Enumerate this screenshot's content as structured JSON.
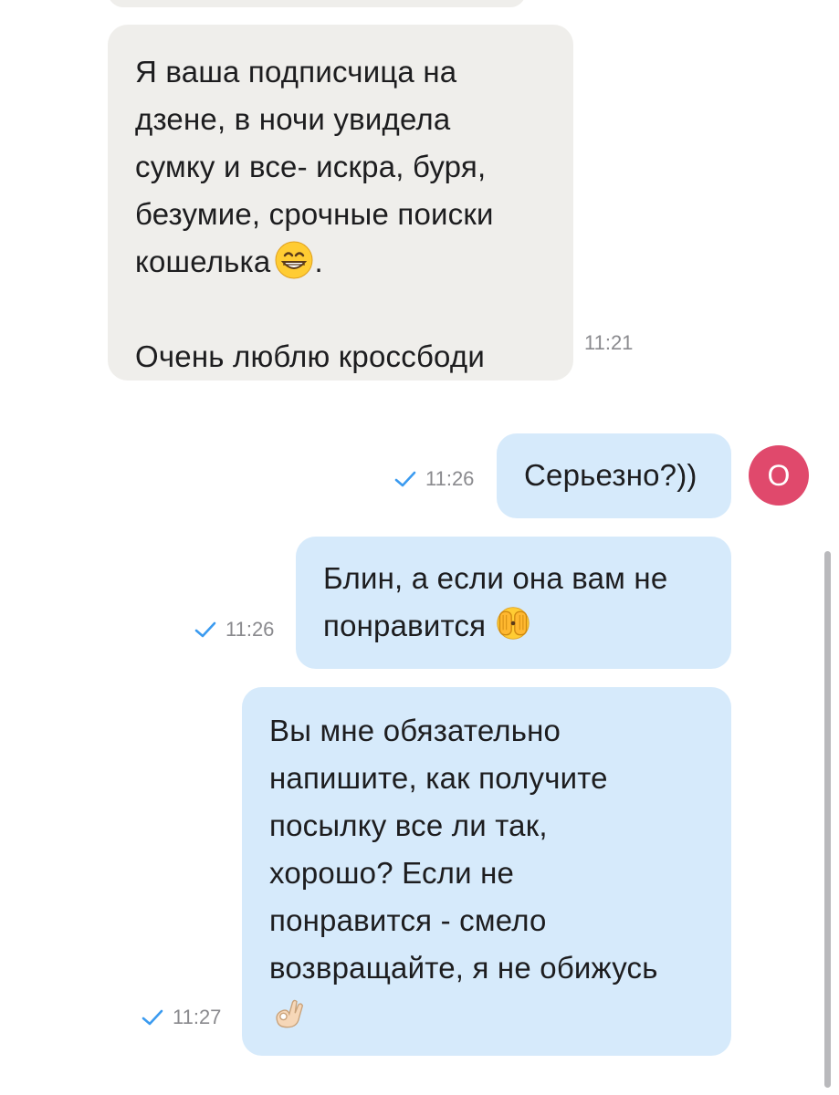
{
  "messages": {
    "m1": {
      "line1": "Я ваша подписчица на\nдзене, в ночи увидела\nсумку и все- искра, буря,\nбезумие, срочные поиски\nкошелька",
      "line1_end": ".",
      "line2": "Очень люблю кроссбоди",
      "time": "11:21"
    },
    "m2": {
      "text": "Серьезно?))",
      "time": "11:26"
    },
    "m3": {
      "text": "Блин, а если она вам не\nпонравится ",
      "time": "11:26"
    },
    "m4": {
      "text": "Вы мне обязательно\nнапишите, как получите\nпосылку все ли так,\nхорошо? Если не\nпонравится - смело\nвозвращайте, я не обижусь",
      "time": "11:27"
    }
  },
  "avatar": {
    "letter": "О",
    "color": "#e0496c"
  },
  "icons": {
    "check": "checkmark-icon",
    "grin": "grinning-face-emoji",
    "hide": "face-hiding-emoji",
    "ok": "ok-hand-emoji"
  },
  "colors": {
    "incoming_bubble": "#efeeeb",
    "outgoing_bubble": "#d6eafb",
    "check": "#3b9bf0",
    "timestamp": "#8a8a8e"
  }
}
